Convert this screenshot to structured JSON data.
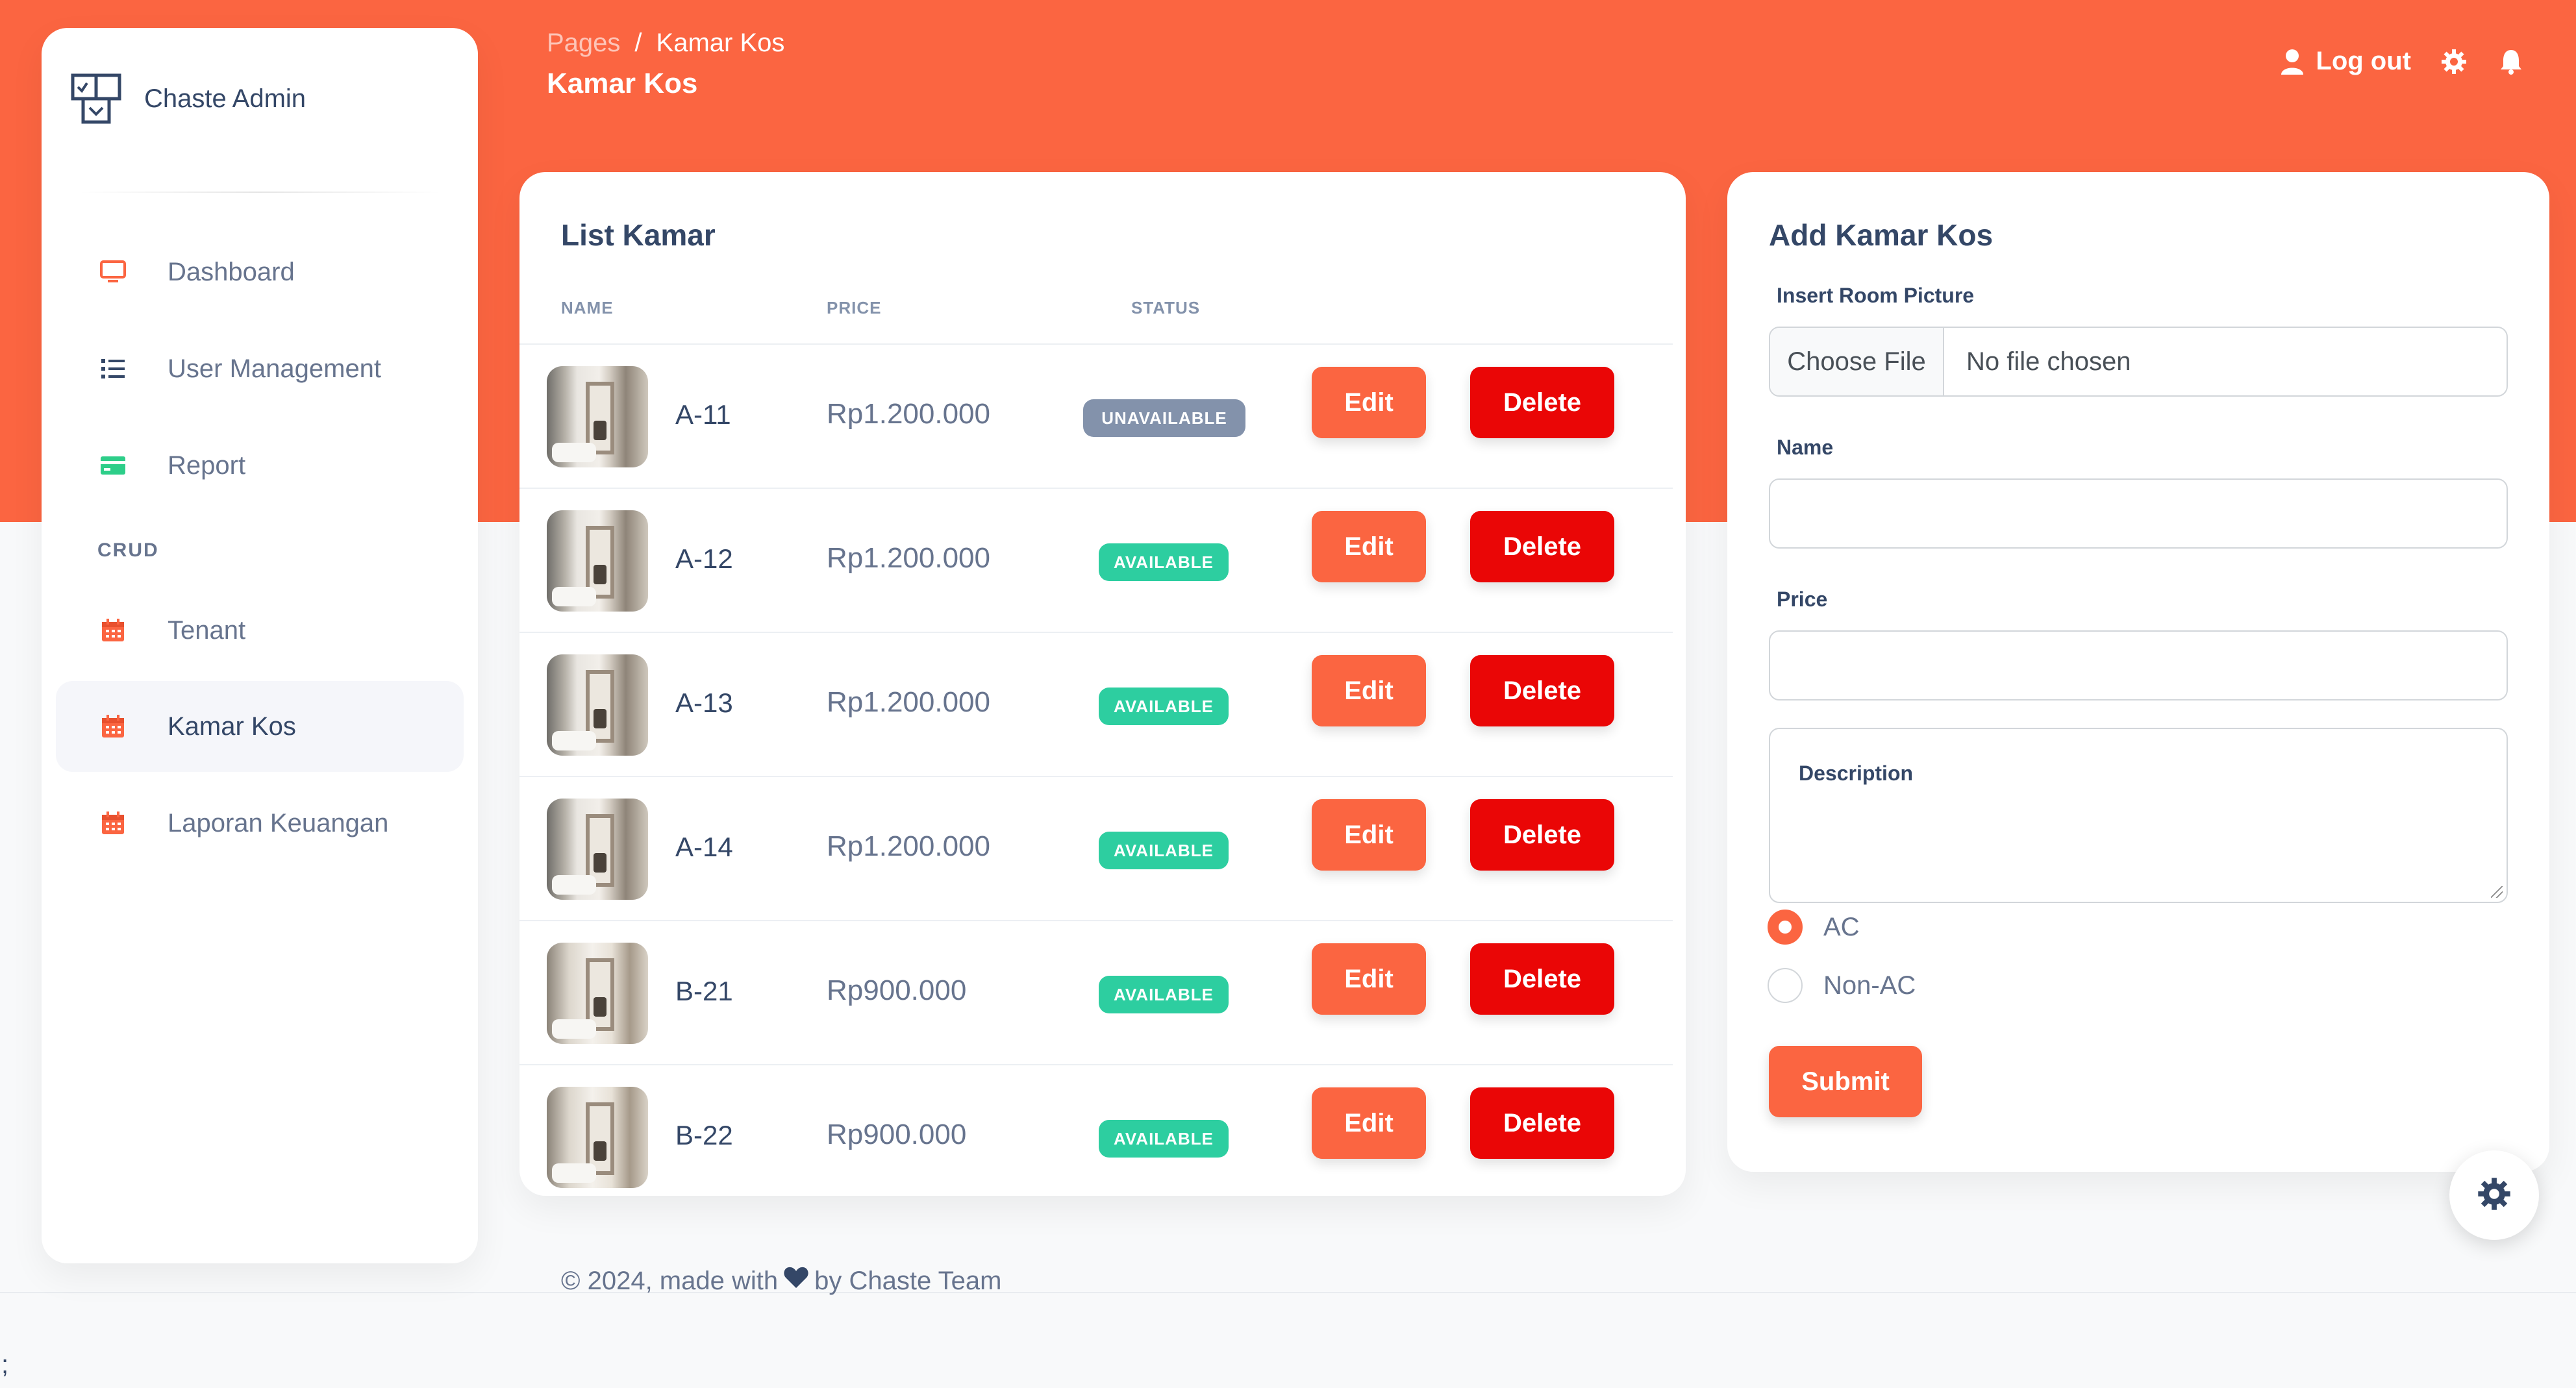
{
  "brand": {
    "name": "Chaste Admin"
  },
  "sidebar": {
    "items": [
      {
        "label": "Dashboard",
        "icon": "monitor-icon"
      },
      {
        "label": "User Management",
        "icon": "list-icon"
      },
      {
        "label": "Report",
        "icon": "credit-card-icon"
      }
    ],
    "section_label": "CRUD",
    "crud_items": [
      {
        "label": "Tenant",
        "icon": "calendar-icon"
      },
      {
        "label": "Kamar Kos",
        "icon": "calendar-icon",
        "active": true
      },
      {
        "label": "Laporan Keuangan",
        "icon": "calendar-icon"
      }
    ]
  },
  "header": {
    "breadcrumb_root": "Pages",
    "breadcrumb_separator": "/",
    "breadcrumb_current": "Kamar Kos",
    "page_title": "Kamar Kos",
    "logout_label": "Log out"
  },
  "list": {
    "title": "List Kamar",
    "columns": [
      "NAME",
      "PRICE",
      "STATUS"
    ],
    "edit_label": "Edit",
    "delete_label": "Delete",
    "rows": [
      {
        "name": "A-11",
        "price": "Rp1.200.000",
        "status": "UNAVAILABLE"
      },
      {
        "name": "A-12",
        "price": "Rp1.200.000",
        "status": "AVAILABLE"
      },
      {
        "name": "A-13",
        "price": "Rp1.200.000",
        "status": "AVAILABLE"
      },
      {
        "name": "A-14",
        "price": "Rp1.200.000",
        "status": "AVAILABLE"
      },
      {
        "name": "B-21",
        "price": "Rp900.000",
        "status": "AVAILABLE"
      },
      {
        "name": "B-22",
        "price": "Rp900.000",
        "status": "AVAILABLE"
      }
    ]
  },
  "form": {
    "title": "Add Kamar Kos",
    "picture_label": "Insert Room Picture",
    "choose_file": "Choose File",
    "no_file": "No file chosen",
    "name_label": "Name",
    "name_value": "",
    "price_label": "Price",
    "price_value": "",
    "description_label": "Description",
    "radio_options": [
      {
        "label": "AC",
        "checked": true
      },
      {
        "label": "Non-AC",
        "checked": false
      }
    ],
    "submit_label": "Submit"
  },
  "footer": {
    "prefix": "© 2024, made with",
    "suffix": "by Chaste Team"
  },
  "stray_text": ";",
  "colors": {
    "accent": "#fb6541",
    "danger": "#ea0606",
    "success": "#2dcea0",
    "muted": "#8392ab"
  }
}
